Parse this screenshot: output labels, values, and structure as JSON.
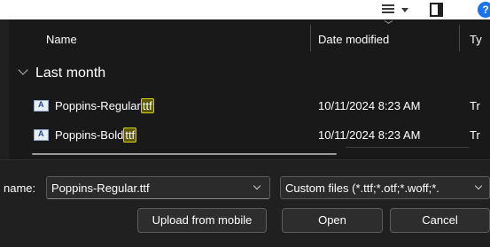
{
  "toolbar": {
    "icons": [
      "view-list-icon",
      "dropdown-arrow-icon",
      "preview-pane-icon",
      "help-icon"
    ],
    "help_glyph": "?"
  },
  "columns": {
    "name": "Name",
    "date_modified": "Date modified",
    "type": "Ty"
  },
  "group": {
    "label": "Last month"
  },
  "files": [
    {
      "name_base": "Poppins-Regular",
      "name_ext": "ttf",
      "date": "10/11/2024 8:23 AM",
      "type": "Tr"
    },
    {
      "name_base": "Poppins-Bold",
      "name_ext": "ttf",
      "date": "10/11/2024 8:23 AM",
      "type": "Tr"
    }
  ],
  "file_name_field": {
    "label": "name:",
    "value": "Poppins-Regular.ttf"
  },
  "file_type_select": {
    "selected": "Custom files (*.ttf;*.otf;*.woff;*."
  },
  "buttons": {
    "upload": "Upload from mobile",
    "open": "Open",
    "cancel": "Cancel"
  },
  "colors": {
    "background": "#202020",
    "highlight_fill": "#5d5a00",
    "highlight_border": "#d6cf1c",
    "help_blue": "#1a73e8"
  }
}
